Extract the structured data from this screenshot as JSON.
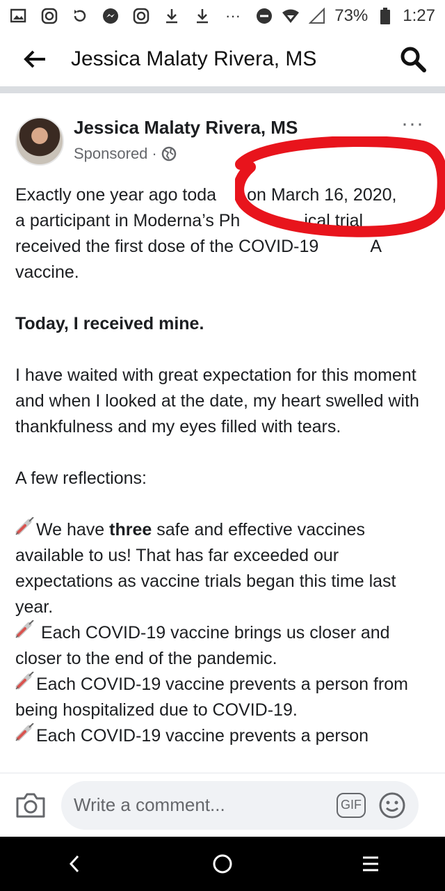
{
  "status_bar": {
    "battery": "73%",
    "time": "1:27",
    "icons": [
      "gallery-icon",
      "instagram-icon",
      "refresh-icon",
      "messenger-icon",
      "instagram-icon",
      "download-icon",
      "download-icon",
      "more-icon",
      "do-not-disturb-icon",
      "wifi-icon",
      "signal-icon",
      "battery-icon"
    ],
    "more": "···"
  },
  "app_bar": {
    "title": "Jessica Malaty Rivera, MS",
    "back_icon": "arrow-left-icon",
    "search_icon": "search-icon"
  },
  "post": {
    "author": "Jessica Malaty Rivera, MS",
    "sponsored": "Sponsored",
    "separator": "·",
    "more": "···",
    "paragraph1_line1": "Exactly one year ago toda",
    "paragraph1_line1b": "on March 16, 2020,",
    "paragraph1_line2": "a participant in Moderna’s Ph",
    "paragraph1_line2b": "ical trial",
    "paragraph1_line3": "received the first dose of the COVID-19",
    "paragraph1_line3b": "A",
    "paragraph1_line4": "vaccine.",
    "paragraph2": "Today, I received mine.",
    "paragraph3": "I have waited with great expectation for this moment and when I looked at the date, my heart swelled with thankfulness and my eyes filled with tears.",
    "paragraph4": "A few reflections:",
    "bullet1_pre": "We have ",
    "bullet1_bold": "three",
    "bullet1_post": " safe and effective vaccines available to us! That has far exceeded our expectations as vaccine trials began this time last year.",
    "bullet2": " Each COVID-19 vaccine brings us closer and closer to the end of the pandemic.",
    "bullet3": "Each COVID-19 vaccine prevents a person from being hospitalized due to COVID-19.",
    "bullet4": "Each COVID-19 vaccine prevents a person"
  },
  "comment_bar": {
    "placeholder": "Write a comment...",
    "gif_label": "GIF"
  },
  "annotation_color": "#e8141c"
}
